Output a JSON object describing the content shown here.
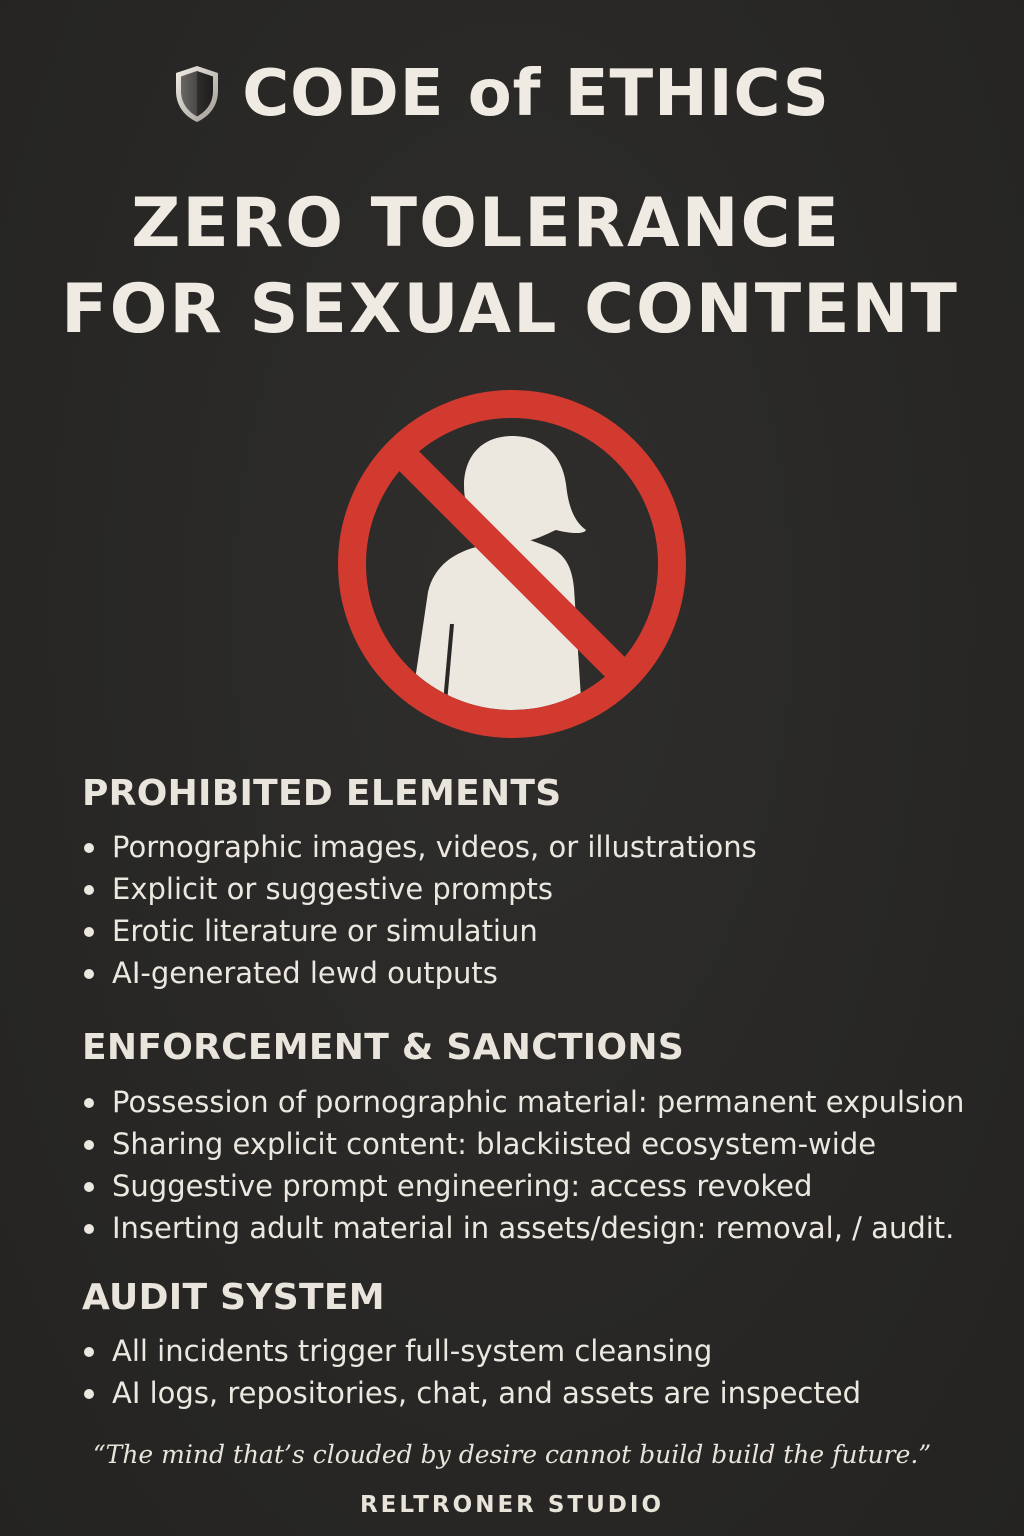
{
  "header": {
    "title": "CODE of ETHICS",
    "headline_line1": "ZERO TOLERANCE",
    "headline_line2": "FOR SEXUAL CONTENT"
  },
  "icons": {
    "header_icon": "shield-icon",
    "main_icon": "prohibited-figure-icon"
  },
  "colors": {
    "background": "#292826",
    "text": "#efebe3",
    "prohibition_red": "#d2392f",
    "figure": "#ece8df"
  },
  "sections": [
    {
      "title": "PROHIBITED ELEMENTS",
      "items": [
        "Pornographic images, videos, or illustrations",
        "Explicit or suggestive prompts",
        "Erotic literature or simulatiun",
        "AI-generated lewd outputs"
      ]
    },
    {
      "title": "ENFORCEMENT & SANCTIONS",
      "items": [
        "Possession of pornographic material: permanent expulsion",
        "Sharing explicit content: blackiisted ecosystem-wide",
        "Suggestive prompt engineering: access revoked",
        "Inserting adult material in assets/design: removal, / audit."
      ]
    },
    {
      "title": "AUDIT SYSTEM",
      "items": [
        "All incidents trigger full-system cleansing",
        "AI logs, repositories, chat, and assets are inspected"
      ]
    }
  ],
  "footer": {
    "quote": "“The mind that’s clouded by desire cannot build build the future.”",
    "studio": "RELTRONER STUDIO"
  }
}
